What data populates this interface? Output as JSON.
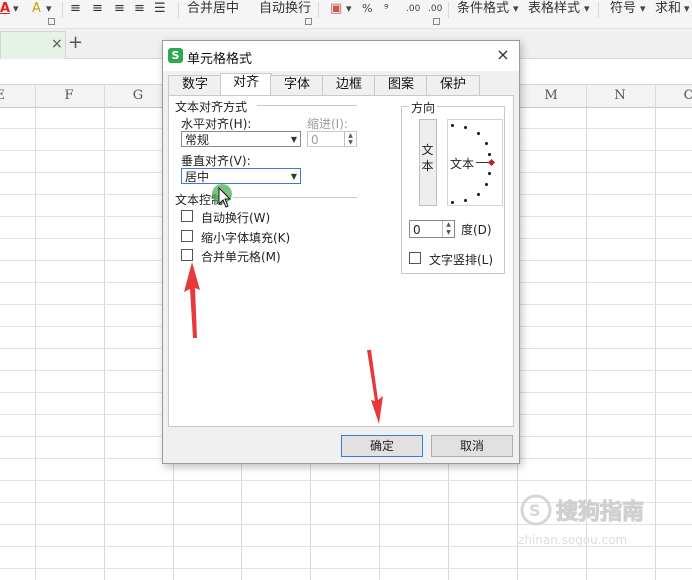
{
  "ribbon": {
    "font_color_letter": "A",
    "fill_letter": "A",
    "merge_center": "合并居中",
    "auto_wrap": "自动换行",
    "percent": "%",
    "thousands": "⁹",
    "decimal_inc": ".00",
    "decimal_dec": ".00",
    "conditional_format": "条件格式",
    "table_style": "表格样式",
    "symbol": "符号",
    "sum": "求和"
  },
  "doc_tab": {
    "close": "×",
    "add": "+"
  },
  "grid": {
    "columns_left": [
      "E",
      "F",
      "G"
    ],
    "columns_right": [
      "M",
      "N",
      "O"
    ]
  },
  "dialog": {
    "title": "单元格格式",
    "close": "×",
    "tabs": [
      "数字",
      "对齐",
      "字体",
      "边框",
      "图案",
      "保护"
    ],
    "active_tab": "对齐",
    "text_align_group": "文本对齐方式",
    "horizontal_label": "水平对齐(H):",
    "horizontal_value": "常规",
    "indent_label": "缩进(I):",
    "indent_value": "0",
    "vertical_label": "垂直对齐(V):",
    "vertical_value": "居中",
    "text_control_group": "文本控制",
    "wrap_text": "自动换行(W)",
    "shrink_fit": "缩小字体填充(K)",
    "merge_cells": "合并单元格(M)",
    "orientation_group": "方向",
    "orientation_vertical_text": "文本",
    "orientation_dial_text": "文本",
    "degree_value": "0",
    "degree_label": "度(D)",
    "vertical_stack": "文字竖排(L)",
    "ok": "确定",
    "cancel": "取消"
  },
  "colors": {
    "annotation_arrow": "#e8393a",
    "accent_green": "#2fa84f",
    "focus_blue": "#3a7bd5"
  }
}
